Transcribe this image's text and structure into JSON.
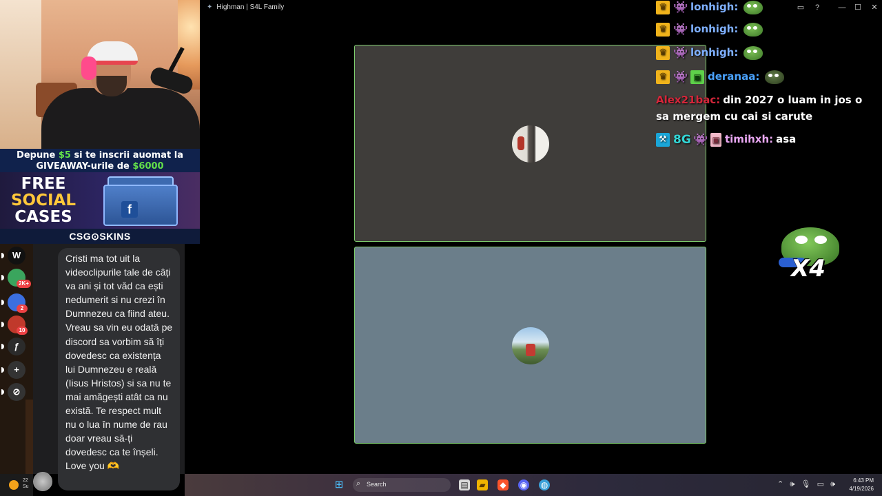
{
  "window": {
    "title": "Highman | S4L Family",
    "controls": [
      "minimize",
      "maximize",
      "close"
    ]
  },
  "promo": {
    "banner_line1_a": "Depune",
    "banner_line1_amount": "$5",
    "banner_line1_b": "si te inscrii auomat la",
    "banner_line2_a": "GIVEAWAY-urile de",
    "banner_line2_amount": "$6000",
    "ad_line1": "FREE",
    "ad_line2": "SOCIAL",
    "ad_line3": "CASES",
    "logo": "CSG⊙SKINS"
  },
  "server_rail": {
    "items": [
      {
        "name": "server-w",
        "label": "W",
        "color": "#111111"
      },
      {
        "name": "server-2k",
        "label": "",
        "badge": "2K+",
        "color": "#3aa55d"
      },
      {
        "name": "server-blue",
        "label": "",
        "badge": "2",
        "color": "#3b6fe0"
      },
      {
        "name": "server-10",
        "label": "",
        "badge": "10",
        "color": "#c0392b"
      },
      {
        "name": "server-f",
        "label": "ƒ",
        "color": "#2b2b2b"
      },
      {
        "name": "add-server",
        "label": "+",
        "color": "#333333"
      },
      {
        "name": "discover",
        "label": "⊘",
        "color": "#333333"
      }
    ]
  },
  "message": {
    "text": "Cristi ma tot uit la videoclipurile tale de câți va ani și tot văd ca ești nedumerit si nu crezi în Dumnezeu ca fiind ateu. Vreau sa vin eu odată pe discord sa vorbim să îți dovedesc ca existența lui Dumnezeu e reală (Iisus Hristos) si sa nu te mai amăgești atât ca nu există. Te respect mult nu o lua în nume de rau doar vreau să-ți dovedesc ca te înșeli. Love you 🫶"
  },
  "chat": {
    "lines": [
      {
        "badges": [
          "crown",
          "robot"
        ],
        "user": "lonhigh:",
        "user_color": "#7fb0ff",
        "text": "",
        "emote": "frog"
      },
      {
        "badges": [
          "crown",
          "robot"
        ],
        "user": "lonhigh:",
        "user_color": "#7fb0ff",
        "text": "",
        "emote": "frog"
      },
      {
        "badges": [
          "crown",
          "robot"
        ],
        "user": "lonhigh:",
        "user_color": "#7fb0ff",
        "text": "",
        "emote": "frog"
      },
      {
        "badges": [
          "crown",
          "robot",
          "gift-green"
        ],
        "user": "deranaa:",
        "user_color": "#4aa3ff",
        "text": "",
        "emote": "frog-dark"
      },
      {
        "badges": [],
        "user": "Alex21bac:",
        "user_color": "#d4263a",
        "text": "din 2027 o luam in jos o sa mergem cu cai si carute",
        "emote": ""
      },
      {
        "badges": [
          "hammer",
          "eightg",
          "robot",
          "gift-pink"
        ],
        "user": "timihxh:",
        "user_color": "#e9a7f2",
        "text": "asa",
        "emote": ""
      }
    ],
    "big_emote_multiplier": "X4"
  },
  "taskbar": {
    "weather_temp": "22",
    "weather_desc": "Su",
    "search_label": "Search",
    "time": "6:43 PM",
    "date": "4/19/2026"
  }
}
